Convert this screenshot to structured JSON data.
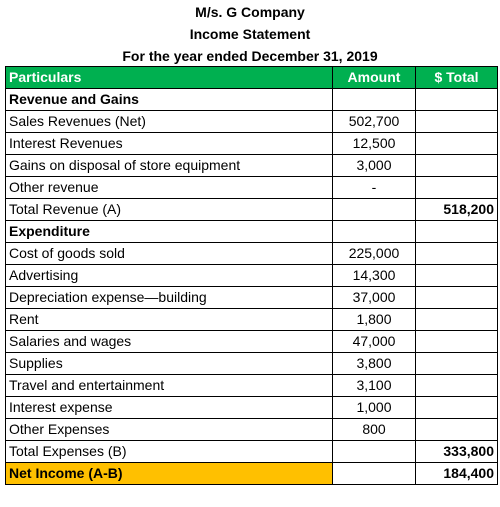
{
  "header": {
    "company": "M/s. G Company",
    "statement": "Income Statement",
    "period": "For the year ended December 31, 2019"
  },
  "colors": {
    "header_bg": "#00b050",
    "header_text": "#ffffff",
    "net_income_bg": "#ffc000"
  },
  "table": {
    "columns": [
      "Particulars",
      "Amount",
      "$ Total"
    ],
    "rows": [
      {
        "type": "section",
        "label": "Revenue and Gains",
        "amount": "",
        "total": ""
      },
      {
        "type": "item",
        "label": "Sales Revenues (Net)",
        "amount": "502,700",
        "total": ""
      },
      {
        "type": "item",
        "label": "Interest Revenues",
        "amount": "12,500",
        "total": ""
      },
      {
        "type": "item",
        "label": "Gains on disposal of store equipment",
        "amount": "3,000",
        "total": ""
      },
      {
        "type": "item",
        "label": "Other revenue",
        "amount": "-",
        "total": ""
      },
      {
        "type": "total",
        "label": "Total Revenue (A)",
        "amount": "",
        "total": "518,200"
      },
      {
        "type": "section",
        "label": "Expenditure",
        "amount": "",
        "total": ""
      },
      {
        "type": "item",
        "label": "Cost of goods sold",
        "amount": "225,000",
        "total": ""
      },
      {
        "type": "item",
        "label": "Advertising",
        "amount": "14,300",
        "total": ""
      },
      {
        "type": "item",
        "label": "Depreciation expense—building",
        "amount": "37,000",
        "total": ""
      },
      {
        "type": "item",
        "label": "Rent",
        "amount": "1,800",
        "total": ""
      },
      {
        "type": "item",
        "label": "Salaries and wages",
        "amount": "47,000",
        "total": ""
      },
      {
        "type": "item",
        "label": "Supplies",
        "amount": "3,800",
        "total": ""
      },
      {
        "type": "item",
        "label": "Travel and entertainment",
        "amount": "3,100",
        "total": ""
      },
      {
        "type": "item",
        "label": "Interest expense",
        "amount": "1,000",
        "total": ""
      },
      {
        "type": "item",
        "label": "Other Expenses",
        "amount": "800",
        "total": ""
      },
      {
        "type": "total",
        "label": "Total Expenses (B)",
        "amount": "",
        "total": "333,800"
      },
      {
        "type": "net",
        "label": "Net Income (A-B)",
        "amount": "",
        "total": "184,400"
      }
    ]
  }
}
